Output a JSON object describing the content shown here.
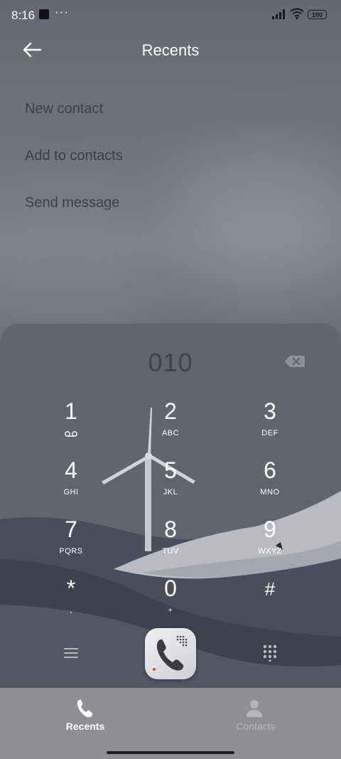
{
  "status": {
    "time": "8:16",
    "dots": "···",
    "battery": "100"
  },
  "header": {
    "title": "Recents"
  },
  "menu": {
    "items": [
      "New contact",
      "Add to contacts",
      "Send message"
    ]
  },
  "dialer": {
    "number": "010",
    "keys": [
      {
        "digit": "1",
        "letters": ""
      },
      {
        "digit": "2",
        "letters": "ABC"
      },
      {
        "digit": "3",
        "letters": "DEF"
      },
      {
        "digit": "4",
        "letters": "GHI"
      },
      {
        "digit": "5",
        "letters": "JKL"
      },
      {
        "digit": "6",
        "letters": "MNO"
      },
      {
        "digit": "7",
        "letters": "PQRS"
      },
      {
        "digit": "8",
        "letters": "TUV"
      },
      {
        "digit": "9",
        "letters": "WXYZ"
      },
      {
        "digit": "*",
        "letters": ","
      },
      {
        "digit": "0",
        "letters": "+"
      },
      {
        "digit": "#",
        "letters": ""
      }
    ]
  },
  "nav": {
    "tabs": [
      {
        "label": "Recents",
        "icon": "phone-icon",
        "active": true
      },
      {
        "label": "Contacts",
        "icon": "person-icon",
        "active": false
      }
    ]
  },
  "colors": {
    "panel": "#62646f",
    "menu_text": "#3c3f4c",
    "nav_bg": "#8e8e93",
    "active_tab": "#ffffff",
    "inactive_tab": "#b4b5ba"
  }
}
